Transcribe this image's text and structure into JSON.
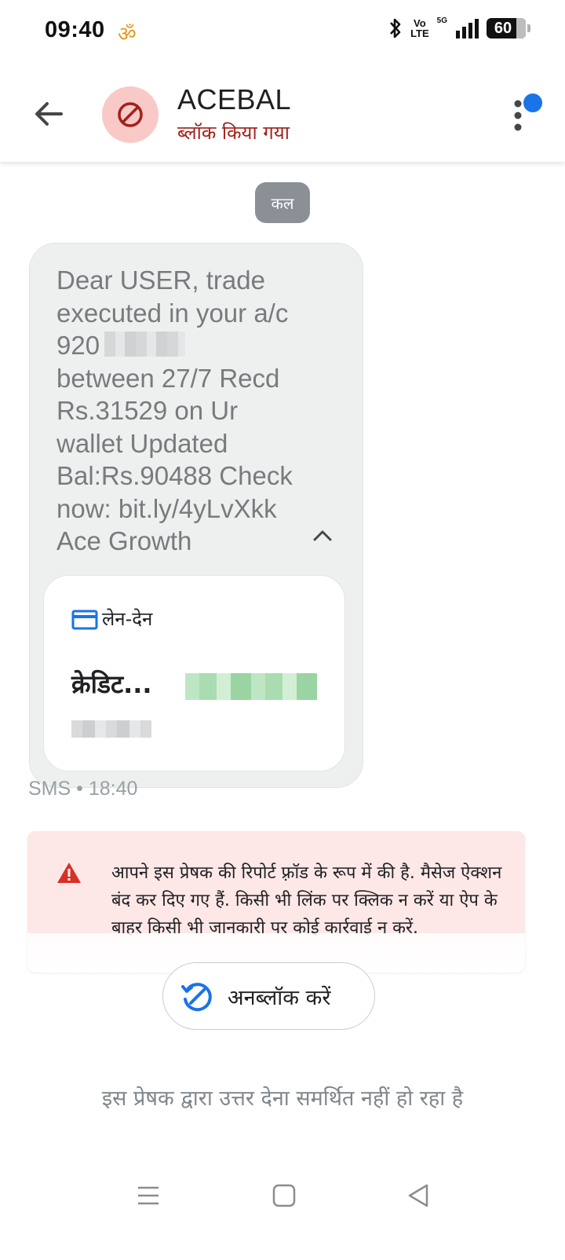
{
  "status_bar": {
    "time": "09:40",
    "om_symbol": "ॐ",
    "volte_top": "Vo",
    "volte_bottom": "LTE",
    "network": "5G",
    "battery": "60"
  },
  "header": {
    "contact_name": "ACEBAL",
    "contact_status": "ब्लॉक किया गया",
    "status_color": "#a2211b",
    "avatar_bg": "#f8c9c6",
    "icons": [
      "back-arrow-icon",
      "block-icon",
      "more-vert-icon"
    ]
  },
  "conversation": {
    "date_chip": "कल",
    "message": {
      "text": "Dear USER, trade\nexecuted in your a/c\n920          27\nbetween 27/7 Recd\nRs.31529 on Ur\nwallet Updated\nBal:Rs.90488 Check\nnow: bit.ly/4yLvXkk\nAce Growth",
      "meta": "SMS • 18:40",
      "card": {
        "label": "लेन-देन",
        "title": "क्रेडिट..."
      }
    }
  },
  "warning": {
    "text": "आपने इस प्रेषक की रिपोर्ट फ़्रॉड के रूप में की है. मैसेज ऐक्शन बंद कर दिए गए हैं. किसी भी लिंक पर क्लिक न करें या ऐप के बाहर किसी भी जानकारी पर कोई कार्रवाई न करें.",
    "icon_color": "#d93025",
    "bg_color": "#fde8e7"
  },
  "unblock_button": {
    "label": "अनब्लॉक करें",
    "icon_color": "#1a73e8"
  },
  "footer_note": "इस प्रेषक द्वारा उत्तर देना समर्थित नहीं हो रहा है",
  "nav": [
    "menu-icon",
    "home-icon",
    "back-icon"
  ]
}
